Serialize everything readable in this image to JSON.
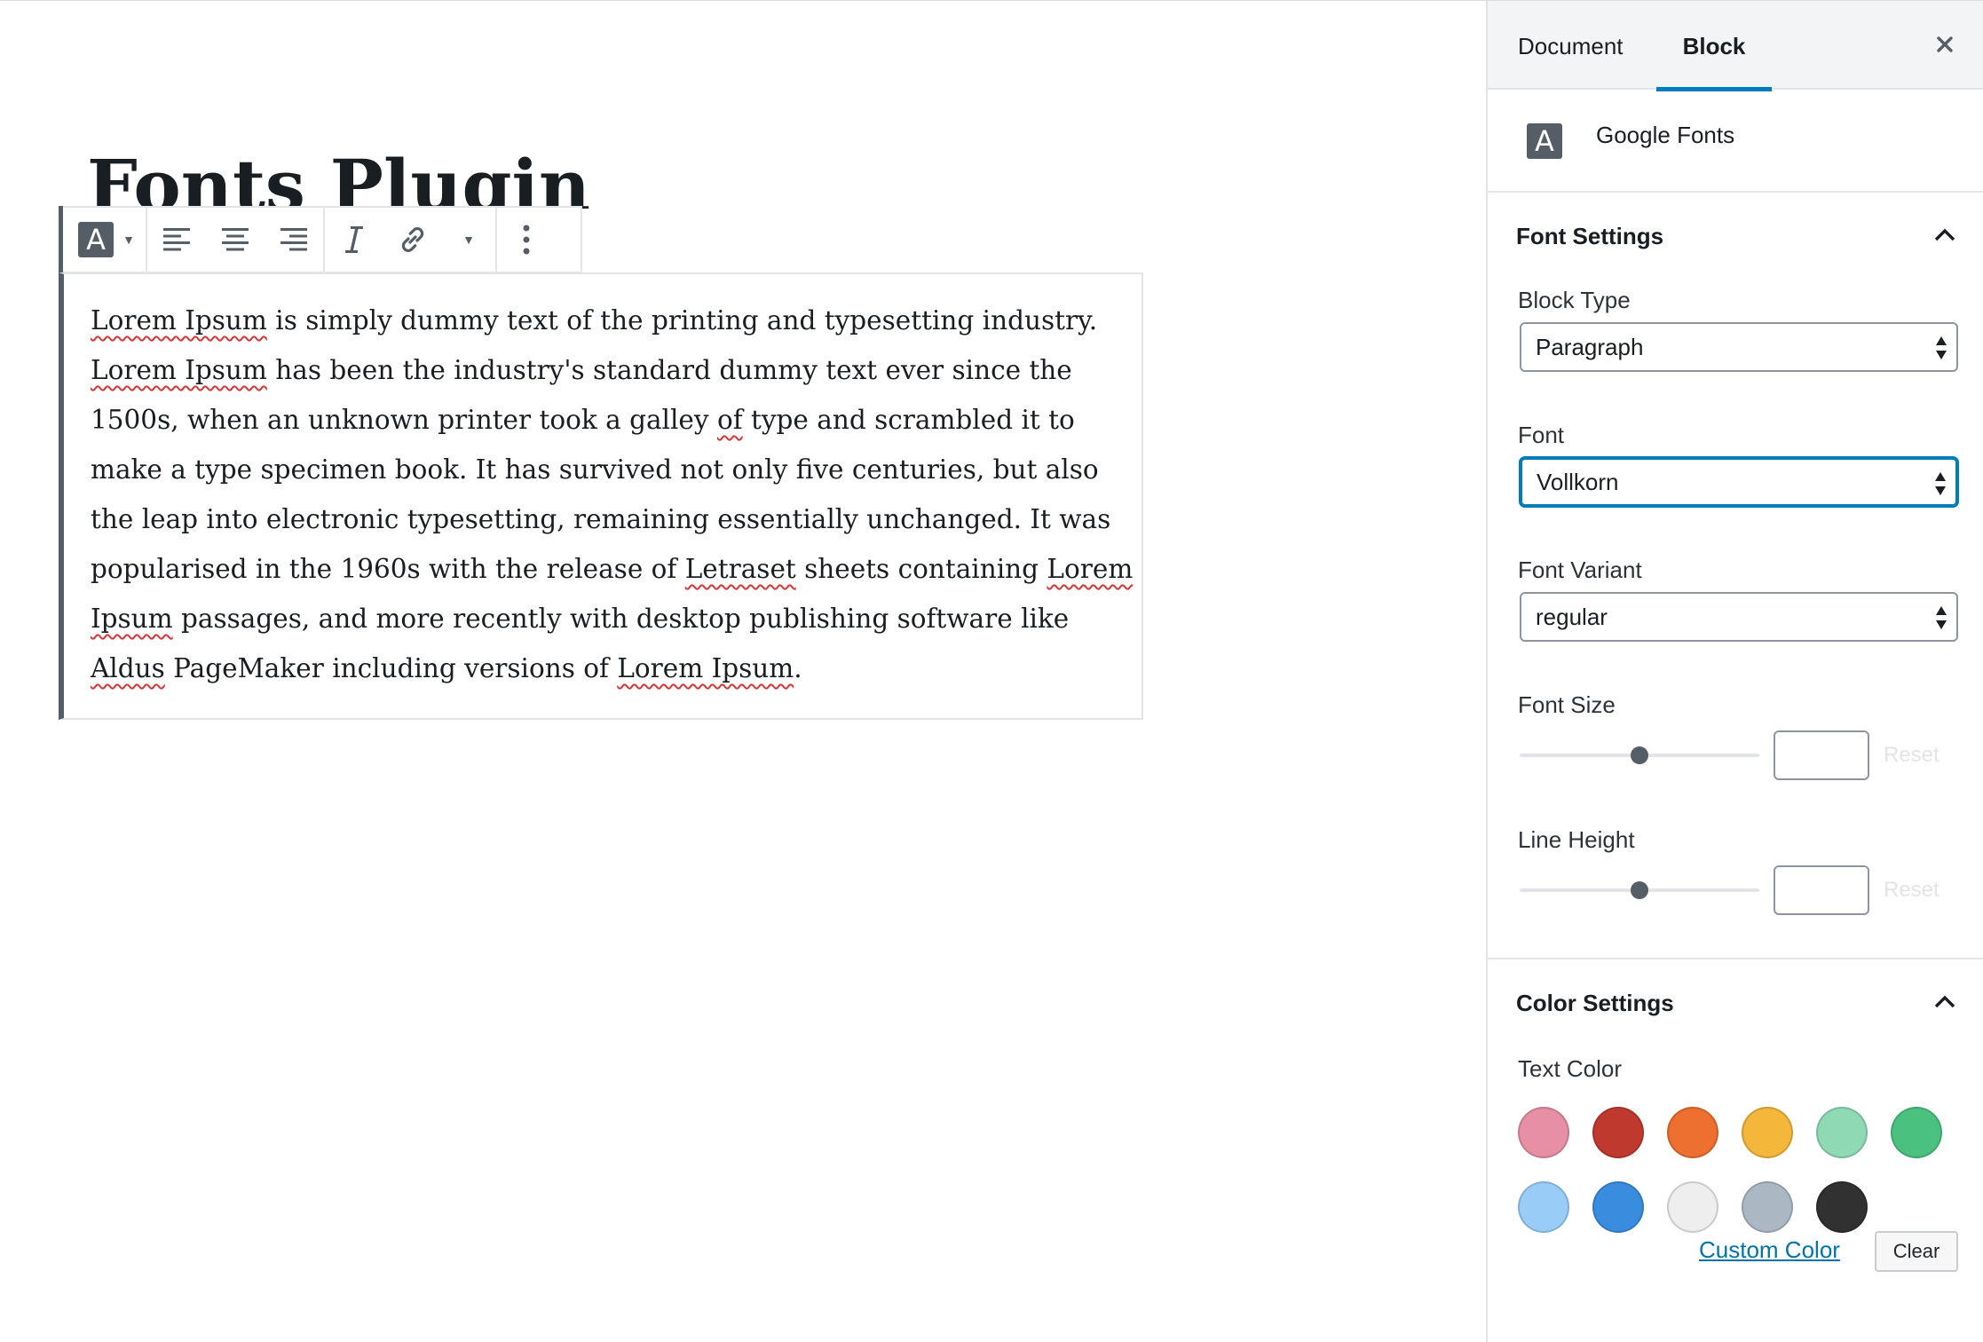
{
  "editor": {
    "post_title": "Fonts Plugin",
    "paragraph_segments": [
      {
        "text": "Lorem Ipsum",
        "spell": true
      },
      {
        "text": " is simply dummy text of the printing and typesetting industry. ",
        "spell": false
      },
      {
        "text": "Lorem Ipsum",
        "spell": true
      },
      {
        "text": " has been the industry's standard dummy text ever since the 1500s, when an unknown printer took a galley ",
        "spell": false
      },
      {
        "text": "of",
        "spell": true
      },
      {
        "text": " type and scrambled it to make a type specimen book. It has survived not only five centuries, but also the leap into electronic typesetting, remaining essentially unchanged. It was popularised in the 1960s with the release of ",
        "spell": false
      },
      {
        "text": "Letraset",
        "spell": true
      },
      {
        "text": " sheets containing ",
        "spell": false
      },
      {
        "text": "Lorem Ipsum",
        "spell": true
      },
      {
        "text": " passages, and more recently with desktop publishing software like ",
        "spell": false
      },
      {
        "text": "Aldus",
        "spell": true
      },
      {
        "text": " PageMaker including versions of ",
        "spell": false
      },
      {
        "text": "Lorem Ipsum",
        "spell": true
      },
      {
        "text": ".",
        "spell": false
      }
    ]
  },
  "toolbar": {
    "font_icon_letter": "A",
    "icons": [
      "google-fonts-icon",
      "align-left-icon",
      "align-center-icon",
      "align-right-icon",
      "italic-icon",
      "link-icon",
      "more-formatting-icon",
      "more-options-icon"
    ]
  },
  "sidebar": {
    "tabs": {
      "document": "Document",
      "block": "Block"
    },
    "block_card": {
      "icon_letter": "A",
      "title": "Google Fonts"
    },
    "font_settings": {
      "title": "Font Settings",
      "block_type_label": "Block Type",
      "block_type_value": "Paragraph",
      "font_label": "Font",
      "font_value": "Vollkorn",
      "font_variant_label": "Font Variant",
      "font_variant_value": "regular",
      "font_size_label": "Font Size",
      "font_size_slider": 0.5,
      "font_size_value": "",
      "line_height_label": "Line Height",
      "line_height_slider": 0.5,
      "line_height_value": "",
      "reset_label": "Reset"
    },
    "color_settings": {
      "title": "Color Settings",
      "text_color_label": "Text Color",
      "swatches": [
        "#e78fa5",
        "#c0392f",
        "#ed7030",
        "#f2b73b",
        "#8fd9b5",
        "#4bc180",
        "#99cdf8",
        "#3a8dde",
        "#eeeeee",
        "#abb8c3",
        "#313131"
      ],
      "custom_color_label": "Custom Color",
      "clear_label": "Clear"
    }
  },
  "colors": {
    "accent": "#007cba",
    "icon_dark": "#555d66",
    "spell_error": "#d63638"
  }
}
